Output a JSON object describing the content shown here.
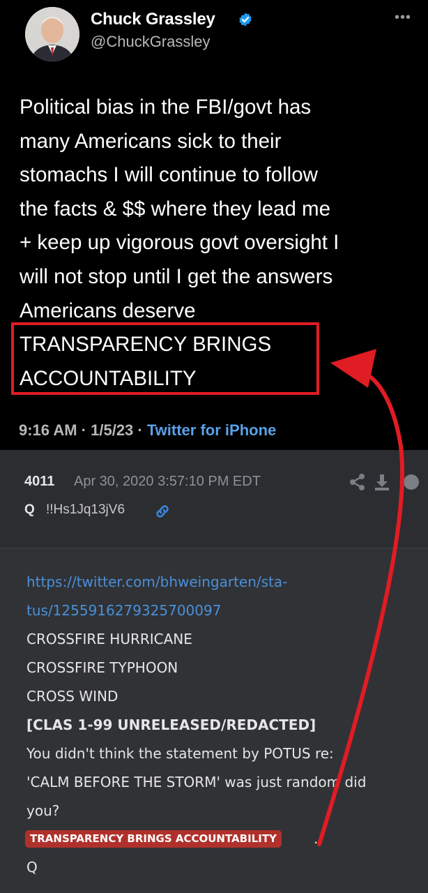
{
  "tweet": {
    "display_name": "Chuck Grassley",
    "handle": "@ChuckGrassley",
    "more_icon": "more-horizontal-icon",
    "verified_icon": "verified-badge-icon",
    "text_lines": [
      "Political bias in the FBI/govt has",
      "many Americans sick to their",
      "stomachs I will continue to follow",
      "the facts & $$ where they lead me",
      "+ keep up vigorous govt oversight I",
      "will not stop until I get the answers",
      "Americans deserve",
      "TRANSPARENCY BRINGS",
      "ACCOUNTABILITY"
    ],
    "time": "9:16 AM",
    "date": "1/5/23",
    "separator": "·",
    "source": "Twitter for iPhone"
  },
  "qpost": {
    "number": "4011",
    "date": "Apr 30, 2020 3:57:10 PM EDT",
    "author": "Q",
    "tripcode": "!!Hs1Jq13jV6",
    "icons": [
      "share-icon",
      "download-icon",
      "circle-icon",
      "link-icon"
    ],
    "url_line1": "https://twitter.com/bhweingarten/sta-",
    "url_line2": "tus/1255916279325700097",
    "lines": [
      "CROSSFIRE HURRICANE",
      "CROSSFIRE TYPHOON",
      "CROSS WIND"
    ],
    "bold_line": "[CLAS 1-99 UNRELEASED/REDACTED]",
    "text_lines": [
      "You didn't think the statement by POTUS re:",
      "'CALM BEFORE THE STORM' was just random did",
      "you?"
    ],
    "badge": "TRANSPARENCY BRINGS ACCOUNTABILITY",
    "badge_trail": ".",
    "signature": "Q"
  },
  "colors": {
    "highlight_red": "#e01c24",
    "link_blue": "#5aa0e6",
    "badge_red": "#b0312b"
  }
}
